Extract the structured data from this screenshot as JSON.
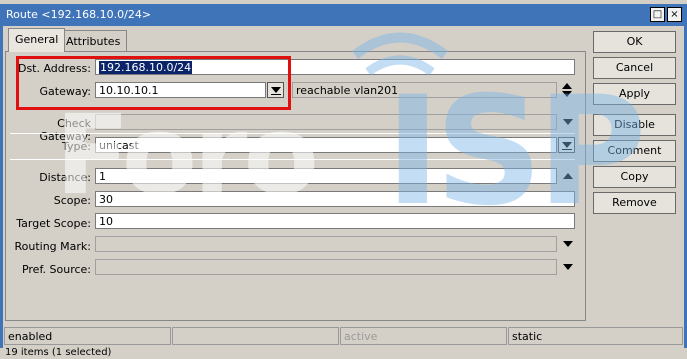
{
  "window": {
    "title": "Route <192.168.10.0/24>",
    "restore_glyph": "□",
    "close_glyph": "×"
  },
  "tabs": [
    {
      "label": "General"
    },
    {
      "label": "Attributes"
    }
  ],
  "form": {
    "dst_address": {
      "label": "Dst. Address:",
      "value": "192.168.10.0/24"
    },
    "gateway": {
      "label": "Gateway:",
      "value": "10.10.10.1",
      "status": "reachable vlan201"
    },
    "check_gateway": {
      "label": "Check Gateway:",
      "value": ""
    },
    "type": {
      "label": "Type:",
      "value": "unicast"
    },
    "distance": {
      "label": "Distance:",
      "value": "1"
    },
    "scope": {
      "label": "Scope:",
      "value": "30"
    },
    "target_scope": {
      "label": "Target Scope:",
      "value": "10"
    },
    "routing_mark": {
      "label": "Routing Mark:",
      "value": ""
    },
    "pref_source": {
      "label": "Pref. Source:",
      "value": ""
    }
  },
  "buttons": {
    "ok": "OK",
    "cancel": "Cancel",
    "apply": "Apply",
    "disable": "Disable",
    "comment": "Comment",
    "copy": "Copy",
    "remove": "Remove"
  },
  "status_bar": {
    "state": "enabled",
    "cell2": "",
    "active": "active",
    "type": "static"
  },
  "footer": {
    "items_count": "19 items (1 selected)"
  },
  "watermark": {
    "text_foro": "Foro",
    "text_isp": "ISP"
  }
}
